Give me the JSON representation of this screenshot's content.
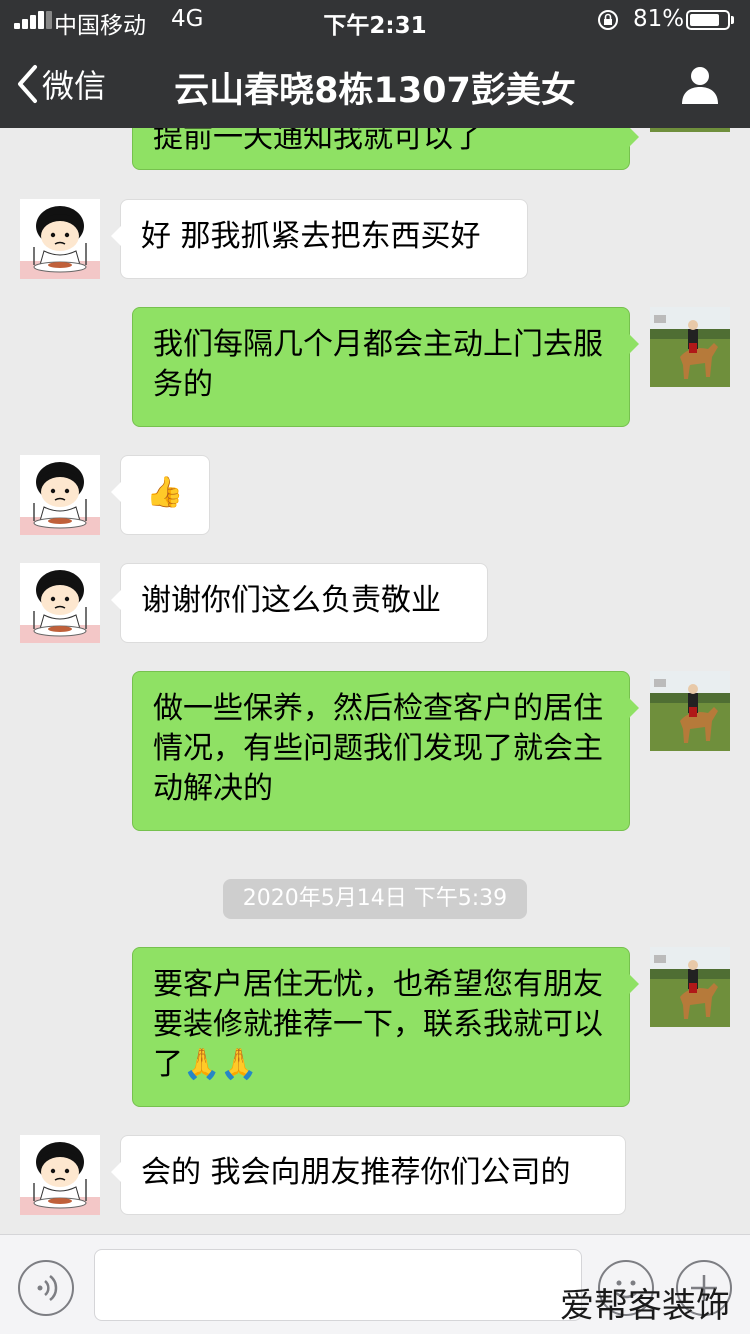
{
  "status_bar": {
    "carrier": "中国移动",
    "network": "4G",
    "time": "下午2:31",
    "battery_percent": "81%",
    "battery_level": 0.81
  },
  "nav": {
    "back_label": "微信",
    "title": "云山春晓8栋1307彭美女"
  },
  "messages": [
    {
      "direction": "out",
      "text": "提前一天通知我就可以了"
    },
    {
      "direction": "in",
      "text": "好 那我抓紧去把东西买好"
    },
    {
      "direction": "out",
      "text": "我们每隔几个月都会主动上门去服务的"
    },
    {
      "direction": "in",
      "text": "👍"
    },
    {
      "direction": "in",
      "text": "谢谢你们这么负责敬业"
    },
    {
      "direction": "out",
      "text": "做一些保养，然后检查客户的居住情况，有些问题我们发现了就会主动解决的"
    },
    {
      "direction": "out",
      "text": "要客户居住无忧，也希望您有朋友要装修就推荐一下，联系我就可以了🙏🙏"
    },
    {
      "direction": "in",
      "text": "会的 我会向朋友推荐你们公司的"
    }
  ],
  "timestamp": "2020年5月14日 下午5:39",
  "watermark": "爱帮客装饰",
  "colors": {
    "header_bg": "#333436",
    "chat_bg": "#ebebeb",
    "outgoing_bubble": "#8fe164",
    "incoming_bubble": "#ffffff"
  }
}
